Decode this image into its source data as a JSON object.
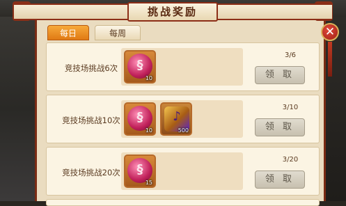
{
  "window": {
    "title": "挑战奖励"
  },
  "tabs": [
    {
      "label": "每日",
      "active": true
    },
    {
      "label": "每周",
      "active": false
    }
  ],
  "tasks": [
    {
      "label": "竞技场挑战6次",
      "progress": "3/6",
      "button": "领 取",
      "rewards": [
        {
          "icon": "pink-orb-icon",
          "qty": "10"
        }
      ]
    },
    {
      "label": "竞技场挑战10次",
      "progress": "3/10",
      "button": "领 取",
      "rewards": [
        {
          "icon": "pink-orb-icon",
          "qty": "10"
        },
        {
          "icon": "horn-icon",
          "qty": "500"
        }
      ]
    },
    {
      "label": "竞技场挑战20次",
      "progress": "3/20",
      "button": "领 取",
      "rewards": [
        {
          "icon": "pink-orb-icon",
          "qty": "15"
        }
      ]
    }
  ],
  "colors": {
    "accent": "#e07a14",
    "frame": "#8c2e17",
    "panel": "#eadcc0"
  }
}
